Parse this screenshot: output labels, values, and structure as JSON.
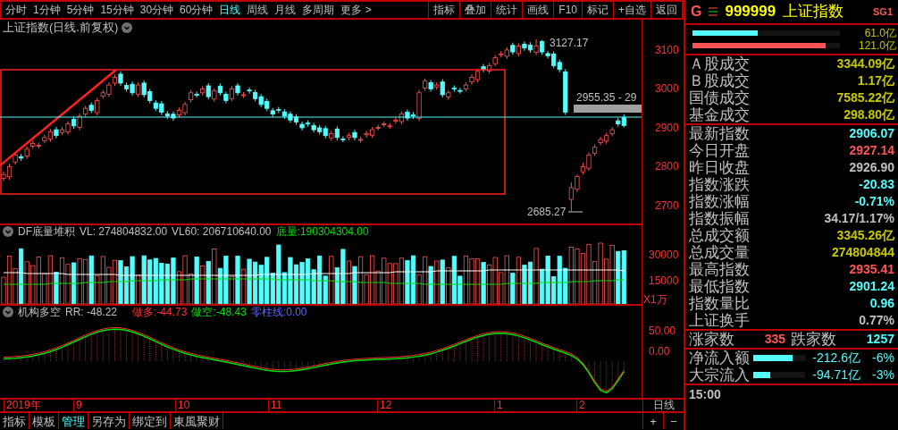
{
  "toolbar": {
    "periods": [
      {
        "label": "分时",
        "selected": false
      },
      {
        "label": "1分钟",
        "selected": false
      },
      {
        "label": "5分钟",
        "selected": false
      },
      {
        "label": "15分钟",
        "selected": false
      },
      {
        "label": "30分钟",
        "selected": false
      },
      {
        "label": "60分钟",
        "selected": false
      },
      {
        "label": "日线",
        "selected": true
      },
      {
        "label": "周线",
        "selected": false
      },
      {
        "label": "月线",
        "selected": false
      },
      {
        "label": "多周期",
        "selected": false
      },
      {
        "label": "更多 >",
        "selected": false
      }
    ],
    "buttons": [
      "指标",
      "叠加",
      "统计",
      "画线",
      "F10",
      "标记",
      "+自选",
      "返回"
    ]
  },
  "chart": {
    "title": "上证指数(日线.前复权)",
    "high_label": "3127.17",
    "low_label": "2685.27",
    "range_label": "2955.35 - 29",
    "chart_data": {
      "type": "candlestick",
      "ylim": [
        2654,
        3178
      ],
      "yticks": [
        3100,
        3000,
        2900,
        2800,
        2700
      ],
      "ohlc": [
        [
          2770,
          2787,
          2763,
          2780
        ],
        [
          2774,
          2807,
          2767,
          2800
        ],
        [
          2812,
          2837,
          2805,
          2830
        ],
        [
          2826,
          2833,
          2815,
          2822
        ],
        [
          2827,
          2852,
          2820,
          2845
        ],
        [
          2853,
          2867,
          2846,
          2860
        ],
        [
          2854,
          2862,
          2847,
          2855
        ],
        [
          2867,
          2882,
          2860,
          2875
        ],
        [
          2871,
          2897,
          2864,
          2890
        ],
        [
          2895,
          2902,
          2873,
          2880
        ],
        [
          2888,
          2902,
          2881,
          2895
        ],
        [
          2889,
          2917,
          2882,
          2910
        ],
        [
          2922,
          2929,
          2898,
          2905
        ],
        [
          2901,
          2937,
          2894,
          2930
        ],
        [
          2935,
          2957,
          2928,
          2950
        ],
        [
          2958,
          2965,
          2938,
          2945
        ],
        [
          2939,
          2977,
          2932,
          2970
        ],
        [
          2982,
          2997,
          2975,
          2990
        ],
        [
          2986,
          3017,
          2979,
          3010
        ],
        [
          3015,
          3037,
          3008,
          3030
        ],
        [
          3038,
          3045,
          3008,
          3015
        ],
        [
          3009,
          3016,
          2993,
          3000
        ],
        [
          3012,
          3019,
          2983,
          2990
        ],
        [
          2986,
          3017,
          2979,
          3010
        ],
        [
          3015,
          3022,
          2978,
          2985
        ],
        [
          2993,
          3000,
          2963,
          2970
        ],
        [
          2964,
          2971,
          2943,
          2950
        ],
        [
          2962,
          2969,
          2933,
          2940
        ],
        [
          2936,
          2943,
          2923,
          2930
        ],
        [
          2935,
          2942,
          2918,
          2925
        ],
        [
          2933,
          2952,
          2926,
          2945
        ],
        [
          2939,
          2967,
          2932,
          2960
        ],
        [
          2972,
          2997,
          2965,
          2990
        ],
        [
          2986,
          2993,
          2978,
          2985
        ],
        [
          2990,
          3007,
          2983,
          3000
        ],
        [
          3008,
          3015,
          2973,
          2980
        ],
        [
          2974,
          3002,
          2967,
          2995
        ],
        [
          3007,
          3014,
          2983,
          2990
        ],
        [
          2986,
          2993,
          2963,
          2970
        ],
        [
          2975,
          3007,
          2968,
          3000
        ],
        [
          3008,
          3015,
          2983,
          2990
        ],
        [
          2984,
          2992,
          2977,
          2985
        ],
        [
          2997,
          3004,
          2988,
          2995
        ],
        [
          2991,
          2998,
          2968,
          2975
        ],
        [
          2980,
          2987,
          2953,
          2960
        ],
        [
          2968,
          2975,
          2943,
          2950
        ],
        [
          2944,
          2951,
          2928,
          2935
        ],
        [
          2947,
          2954,
          2938,
          2945
        ],
        [
          2941,
          2948,
          2923,
          2930
        ],
        [
          2935,
          2942,
          2913,
          2920
        ],
        [
          2928,
          2935,
          2908,
          2915
        ],
        [
          2909,
          2916,
          2893,
          2900
        ],
        [
          2912,
          2919,
          2903,
          2910
        ],
        [
          2906,
          2913,
          2888,
          2895
        ],
        [
          2900,
          2907,
          2883,
          2890
        ],
        [
          2898,
          2905,
          2873,
          2880
        ],
        [
          2874,
          2892,
          2867,
          2885
        ],
        [
          2897,
          2904,
          2868,
          2875
        ],
        [
          2871,
          2878,
          2863,
          2870
        ],
        [
          2875,
          2887,
          2868,
          2880
        ],
        [
          2888,
          2895,
          2868,
          2875
        ],
        [
          2869,
          2877,
          2862,
          2870
        ],
        [
          2882,
          2892,
          2875,
          2885
        ],
        [
          2881,
          2902,
          2874,
          2895
        ],
        [
          2900,
          2908,
          2893,
          2901
        ],
        [
          2909,
          2917,
          2902,
          2910
        ],
        [
          2904,
          2912,
          2897,
          2905
        ],
        [
          2917,
          2927,
          2910,
          2920
        ],
        [
          2916,
          2942,
          2909,
          2935
        ],
        [
          2940,
          2947,
          2918,
          2925
        ],
        [
          2933,
          2940,
          2923,
          2930
        ],
        [
          2924,
          2997,
          2917,
          2990
        ],
        [
          3002,
          3027,
          2995,
          3020
        ],
        [
          3016,
          3023,
          2993,
          3000
        ],
        [
          3005,
          3017,
          2998,
          3010
        ],
        [
          3018,
          3025,
          2978,
          2985
        ],
        [
          2979,
          2997,
          2972,
          2990
        ],
        [
          3002,
          3009,
          2993,
          3000
        ],
        [
          2996,
          3003,
          2988,
          2995
        ],
        [
          3000,
          3017,
          2993,
          3010
        ],
        [
          3018,
          3037,
          3011,
          3030
        ],
        [
          3024,
          3052,
          3017,
          3045
        ],
        [
          3057,
          3064,
          3043,
          3050
        ],
        [
          3046,
          3067,
          3039,
          3060
        ],
        [
          3065,
          3087,
          3058,
          3080
        ],
        [
          3088,
          3097,
          3081,
          3090
        ],
        [
          3084,
          3107,
          3077,
          3100
        ],
        [
          3112,
          3119,
          3088,
          3095
        ],
        [
          3091,
          3117,
          3084,
          3110
        ],
        [
          3115,
          3122,
          3098,
          3105
        ],
        [
          3113,
          3120,
          3093,
          3100
        ],
        [
          3094,
          3127,
          3087,
          3110
        ],
        [
          3122,
          3126,
          3088,
          3095
        ],
        [
          3091,
          3098,
          3078,
          3085
        ],
        [
          3090,
          3097,
          3053,
          3060
        ],
        [
          3068,
          3075,
          3043,
          3050
        ],
        [
          3044,
          3051,
          2933,
          2940
        ],
        [
          2716,
          2760,
          2685,
          2746
        ],
        [
          2742,
          2780,
          2735,
          2775
        ],
        [
          2787,
          2810,
          2780,
          2800
        ],
        [
          2796,
          2837,
          2789,
          2830
        ],
        [
          2835,
          2857,
          2828,
          2850
        ],
        [
          2862,
          2877,
          2855,
          2870
        ],
        [
          2866,
          2887,
          2859,
          2880
        ],
        [
          2885,
          2902,
          2878,
          2895
        ],
        [
          2918,
          2925,
          2903,
          2910
        ],
        [
          2927,
          2935,
          2901,
          2906
        ]
      ]
    }
  },
  "volume": {
    "name": "DF底量堆积",
    "vl": "VL: 274804832.00",
    "vl60": "VL60: 206710640.00",
    "base_label": "底量:",
    "base_value": "190304304.00",
    "ticks": [
      "30000",
      "15000"
    ],
    "unit": "X1万"
  },
  "indicator": {
    "name": "机构多空",
    "rr": "RR: -48.22",
    "items": [
      {
        "label": "做多:",
        "value": "-44.73",
        "color": "#ff3030"
      },
      {
        "label": "做空:",
        "value": "-48.43",
        "color": "#00e000"
      },
      {
        "label": "零柱线:",
        "value": "0.00",
        "color": "#6464ff"
      }
    ],
    "ticks": [
      "50.00",
      "0.00"
    ]
  },
  "time_axis": {
    "labels": [
      "2019年",
      "9",
      "10",
      "11",
      "12",
      "1",
      "2"
    ],
    "period": "日线"
  },
  "bottom_tabs": [
    {
      "label": "指标",
      "selected": false
    },
    {
      "label": "模板",
      "selected": false
    },
    {
      "label": "管理",
      "selected": true
    },
    {
      "label": "另存为",
      "selected": false
    },
    {
      "label": "绑定到",
      "selected": false
    },
    {
      "label": "東風聚财",
      "selected": false
    }
  ],
  "zoom_buttons": [
    "+",
    "−"
  ],
  "quote": {
    "market": "G",
    "code": "999999",
    "name": "上证指数",
    "tag": "SG1",
    "flow_bars": [
      {
        "value": "61.0亿",
        "level": 0.44,
        "color": "#54fcfc"
      },
      {
        "value": "121.0亿",
        "level": 0.9,
        "color": "#ff5454"
      }
    ],
    "turnover": [
      {
        "label": "Ａ股成交",
        "value": "3344.09亿"
      },
      {
        "label": "Ｂ股成交",
        "value": "1.17亿"
      },
      {
        "label": "国债成交",
        "value": "7585.22亿"
      },
      {
        "label": "基金成交",
        "value": "298.80亿"
      }
    ],
    "stats": [
      {
        "label": "最新指数",
        "value": "2906.07",
        "color": "#54fcfc"
      },
      {
        "label": "今日开盘",
        "value": "2927.14",
        "color": "#ff5454"
      },
      {
        "label": "昨日收盘",
        "value": "2926.90",
        "color": "#c0c0c0"
      },
      {
        "label": "指数涨跌",
        "value": "-20.83",
        "color": "#54fcfc"
      },
      {
        "label": "指数涨幅",
        "value": "-0.71%",
        "color": "#54fcfc"
      },
      {
        "label": "指数振幅",
        "value": "34.17/1.17%",
        "color": "#c0c0c0"
      },
      {
        "label": "总成交额",
        "value": "3345.26亿",
        "color": "#c8c800"
      },
      {
        "label": "总成交量",
        "value": "274804844",
        "color": "#c8c800"
      },
      {
        "label": "最高指数",
        "value": "2935.41",
        "color": "#ff5454"
      },
      {
        "label": "最低指数",
        "value": "2901.24",
        "color": "#54fcfc"
      },
      {
        "label": "指数量比",
        "value": "0.96",
        "color": "#54fcfc"
      },
      {
        "label": "上证换手",
        "value": "0.77%",
        "color": "#c0c0c0"
      }
    ],
    "breadth": {
      "up_label": "涨家数",
      "up_value": "335",
      "down_label": "跌家数",
      "down_value": "1257"
    },
    "flows": [
      {
        "label": "净流入额",
        "level": 0.75,
        "value": "-212.6亿",
        "pct": "-6%"
      },
      {
        "label": "大宗流入",
        "level": 0.33,
        "value": "-94.71亿",
        "pct": "-3%"
      }
    ],
    "time": "15:00"
  }
}
